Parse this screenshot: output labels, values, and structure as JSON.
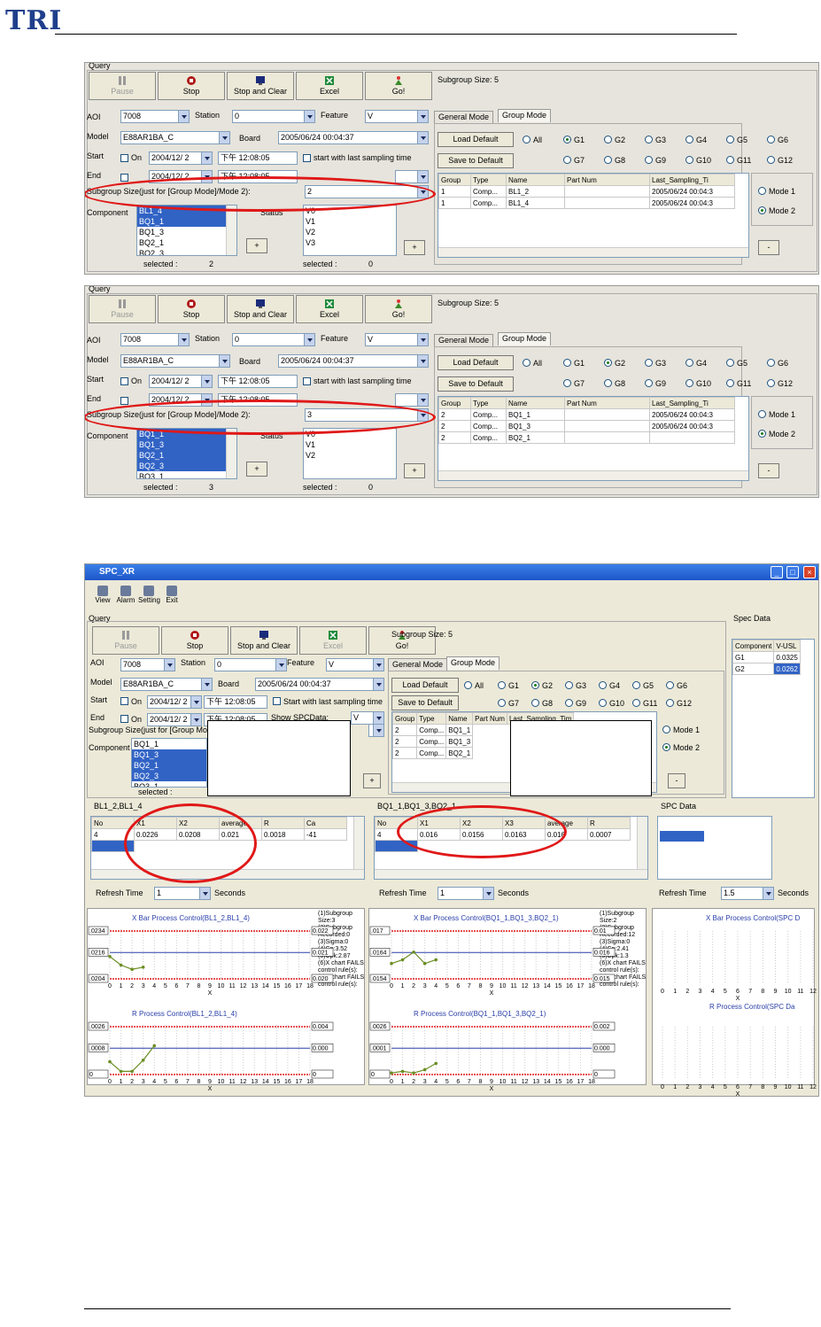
{
  "header": {
    "logo": "TRI"
  },
  "toolbar": {
    "pause": "Pause",
    "stop": "Stop",
    "stop_clear": "Stop and Clear",
    "excel": "Excel",
    "go": "Go!"
  },
  "panels": [
    {
      "query_label": "Query",
      "subgroup_size": "Subgroup Size:  5",
      "aoi_label": "AOI",
      "aoi": "7008",
      "station_label": "Station",
      "station": "0",
      "feature_label": "Feature",
      "feature": "V",
      "model_label": "Model",
      "model": "E88AR1BA_C",
      "board_label": "Board",
      "board": "2005/06/24 00:04:37",
      "start_label": "Start",
      "on_label": "On",
      "start_date": "2004/12/ 2",
      "start_time": "下午 12:08:05",
      "end_label": "End",
      "end_date": "2004/12/ 2",
      "end_time": "下午 12:08:05",
      "start_last": "start with last sampling time",
      "show_spc": "Show SPCData:",
      "subgroup_label": "Subgroup Size(just for [Group Mode]/Mode 2):",
      "subgroup_value": "2",
      "component_label": "Component",
      "components": [
        "BL1_4",
        "BQ1_1",
        "BQ1_3",
        "BQ2_1",
        "BQ2_3"
      ],
      "comp_sel": [
        0,
        1
      ],
      "selected_label": "selected :",
      "selected_count": "2",
      "status_label": "Status",
      "status_items": [
        "V0",
        "V1",
        "V2",
        "V3"
      ],
      "status_selected": "0",
      "tab_general": "General Mode",
      "tab_group": "Group Mode",
      "load_default": "Load Default",
      "save_default": "Save to Default",
      "groups": [
        "All",
        "G1",
        "G2",
        "G3",
        "G4",
        "G5",
        "G6",
        "G7",
        "G8",
        "G9",
        "G10",
        "G11",
        "G12"
      ],
      "group_on": 1,
      "table_headers": [
        "Group",
        "Type",
        "Name",
        "Part Num",
        "Last_Sampling_Ti"
      ],
      "rows": [
        [
          "1",
          "Comp...",
          "BL1_2",
          "",
          "2005/06/24 00:04:3"
        ],
        [
          "1",
          "Comp...",
          "BL1_4",
          "",
          "2005/06/24 00:04:3"
        ]
      ],
      "mode1": "Mode 1",
      "mode2": "Mode 2",
      "plus": "+",
      "minus": "-"
    },
    {
      "query_label": "Query",
      "subgroup_size": "Subgroup Size:  5",
      "aoi_label": "AOI",
      "aoi": "7008",
      "station_label": "Station",
      "station": "0",
      "feature_label": "Feature",
      "feature": "V",
      "model_label": "Model",
      "model": "E88AR1BA_C",
      "board_label": "Board",
      "board": "2005/06/24 00:04:37",
      "start_label": "Start",
      "on_label": "On",
      "start_date": "2004/12/ 2",
      "start_time": "下午 12:08:05",
      "end_label": "End",
      "end_date": "2004/12/ 2",
      "end_time": "下午 12:08:05",
      "start_last": "start with last sampling time",
      "show_spc": "Show SPCData:",
      "subgroup_label": "Subgroup Size(just for [Group Mode]/Mode 2):",
      "subgroup_value": "3",
      "component_label": "Component",
      "components": [
        "BQ1_1",
        "BQ1_3",
        "BQ2_1",
        "BQ2_3",
        "BQ3_1"
      ],
      "comp_sel": [
        0,
        1,
        2,
        3
      ],
      "selected_label": "selected :",
      "selected_count": "3",
      "status_label": "Status",
      "status_items": [
        "V0",
        "V1",
        "V2"
      ],
      "status_selected": "0",
      "tab_general": "General Mode",
      "tab_group": "Group Mode",
      "load_default": "Load Default",
      "save_default": "Save to Default",
      "groups": [
        "All",
        "G1",
        "G2",
        "G3",
        "G4",
        "G5",
        "G6",
        "G7",
        "G8",
        "G9",
        "G10",
        "G11",
        "G12"
      ],
      "group_on": 2,
      "table_headers": [
        "Group",
        "Type",
        "Name",
        "Part Num",
        "Last_Sampling_Ti"
      ],
      "rows": [
        [
          "2",
          "Comp...",
          "BQ1_1",
          "",
          "2005/06/24 00:04:3"
        ],
        [
          "2",
          "Comp...",
          "BQ1_3",
          "",
          "2005/06/24 00:04:3"
        ],
        [
          "2",
          "Comp...",
          "BQ2_1",
          "",
          ""
        ]
      ],
      "mode1": "Mode 1",
      "mode2": "Mode 2",
      "plus": "+",
      "minus": "-"
    }
  ],
  "window": {
    "title": "SPC_XR",
    "menu": [
      "View",
      "Alarm",
      "Setting",
      "Exit"
    ],
    "query_label": "Query",
    "subgroup_size": "Subgroup Size:  5",
    "aoi_label": "AOI",
    "aoi": "7008",
    "station_label": "Station",
    "station": "0",
    "feature_label": "Feature",
    "feature": "V",
    "model_label": "Model",
    "model": "E88AR1BA_C",
    "board_label": "Board",
    "board": "2005/06/24 00:04:37",
    "start_label": "Start",
    "on_label": "On",
    "start_date": "2004/12/ 2",
    "start_time": "下午 12:08:05",
    "end_label": "End",
    "end_date": "2004/12/ 2",
    "end_time": "下午 12:08:05",
    "start_last": "Start with last sampling time",
    "show_spc": "Show SPCData:",
    "show_spc_val": "V",
    "subgroup_label": "Subgroup Size(just for [Group Mod",
    "component_label": "Component",
    "components": [
      "BQ1_1",
      "BQ1_3",
      "BQ2_1",
      "BQ2_3",
      "BQ3_1"
    ],
    "comp_sel": [
      1,
      2,
      3
    ],
    "selected_label": "selected :",
    "tab_general": "General Mode",
    "tab_group": "Group Mode",
    "load_default": "Load Default",
    "save_default": "Save to Default",
    "groups": [
      "All",
      "G1",
      "G2",
      "G3",
      "G4",
      "G5",
      "G6",
      "G7",
      "G8",
      "G9",
      "G10",
      "G11",
      "G12"
    ],
    "group_on": 2,
    "table_headers": [
      "Group",
      "Type",
      "Name",
      "Part Num",
      "Last_Sampling_Tim"
    ],
    "rows": [
      [
        "2",
        "Comp...",
        "BQ1_1"
      ],
      [
        "2",
        "Comp...",
        "BQ1_3"
      ],
      [
        "2",
        "Comp...",
        "BQ2_1"
      ]
    ],
    "mode1": "Mode 1",
    "mode2": "Mode 2",
    "plus": "+",
    "minus": "-",
    "spec_label": "Spec Data",
    "spec_headers": [
      "Component",
      "V-USL"
    ],
    "spec_rows": [
      [
        "G1",
        "0.0325"
      ],
      [
        "G2",
        "0.0262"
      ]
    ],
    "grp1_label": "BL1_2,BL1_4",
    "grp1_headers": [
      "No",
      "X1",
      "X2",
      "average",
      "R",
      "Ca"
    ],
    "grp1_row": [
      "4",
      "0.0226",
      "0.0208",
      "0.021",
      "0.0018",
      "-41"
    ],
    "grp2_label": "BQ1_1,BQ1_3,BQ2_1",
    "grp2_headers": [
      "No",
      "X1",
      "X2",
      "X3",
      "average",
      "R"
    ],
    "grp2_row": [
      "4",
      "0.016",
      "0.0156",
      "0.0163",
      "0.016",
      "0.0007"
    ],
    "spc_label": "SPC Data",
    "refresh_label": "Refresh Time",
    "seconds": "Seconds",
    "refresh1": "1",
    "refresh2": "1",
    "refresh3": "1.5",
    "c1_xtitle": "X Bar Process Control(BL1_2,BL1_4)",
    "c1_rtitle": "R Process Control(BL1_2,BL1_4)",
    "c2_xtitle": "X Bar Process Control(BQ1_1,BQ1_3,BQ2_1)",
    "c2_rtitle": "R Process Control(BQ1_1,BQ1_3,BQ2_1)",
    "c3_xtitle": "X Bar Process Control(SPC D",
    "c3_rtitle": "R Process Control(SPC Da",
    "c1_side": "(1)Subgroup Size:3\n(2)Subgroup Recorded:0\n(3)Sigma:0\n(4)Cp:3.52\n(5)Cpk:2.87\n(6)X chart FAILS control rule(s):\n(7)R chart FAILS control rule(s):",
    "c2_side": "(1)Subgroup Size:2\n(2)Subgroup Recorded:12\n(3)Sigma:0\n(4)Cp:2.41\n(5)Cpk:1.3\n(6)X chart FAILS control rule(s):\n(7)R chart FAILS control rule(s):",
    "c1x_left": [
      ".0234",
      ".0216",
      ".0204"
    ],
    "c1x_right": [
      "0.022",
      "0.021",
      "0.020"
    ],
    "c1r_left": [
      ".0026",
      ".0008",
      "0"
    ],
    "c1r_right": [
      "0.004",
      "0.000",
      "0"
    ],
    "c2x_left": [
      ".017",
      ".0164",
      ".0154"
    ],
    "c2x_right": [
      "0.01",
      "0.016",
      "0.015"
    ],
    "c2r_left": [
      ".0026",
      ".0001",
      "0"
    ],
    "c2r_right": [
      "0.002",
      "0.000",
      "0"
    ],
    "x_ticks": [
      "0",
      "1",
      "2",
      "3",
      "4",
      "5",
      "6",
      "7",
      "8",
      "9",
      "10",
      "11",
      "12",
      "13",
      "14",
      "15",
      "16",
      "17",
      "18"
    ],
    "x_ticks3": [
      "0",
      "1",
      "2",
      "3",
      "4",
      "5",
      "6",
      "7",
      "8",
      "9",
      "10",
      "11",
      "12"
    ],
    "x_axis": "X"
  },
  "chart_data": [
    {
      "type": "line",
      "title": "X Bar Process Control(BL1_2,BL1_4)",
      "x": [
        0,
        1,
        2,
        3
      ],
      "values": [
        0.0216,
        0.0208,
        0.0204,
        0.0206
      ],
      "ylim": [
        0.0195,
        0.024
      ]
    },
    {
      "type": "line",
      "title": "R Process Control(BL1_2,BL1_4)",
      "x": [
        0,
        1,
        2,
        3,
        4
      ],
      "values": [
        0.0008,
        0.0002,
        0.0002,
        0.0009,
        0.0018
      ],
      "ylim": [
        0,
        0.003
      ]
    },
    {
      "type": "line",
      "title": "X Bar Process Control(BQ1_1,BQ1_3,BQ2_1)",
      "x": [
        0,
        1,
        2,
        3,
        4
      ],
      "values": [
        0.0158,
        0.016,
        0.0164,
        0.0158,
        0.016
      ],
      "ylim": [
        0.015,
        0.0175
      ]
    },
    {
      "type": "line",
      "title": "R Process Control(BQ1_1,BQ1_3,BQ2_1)",
      "x": [
        0,
        1,
        2,
        3,
        4
      ],
      "values": [
        0.0001,
        0.0002,
        0.0001,
        0.0003,
        0.0007
      ],
      "ylim": [
        0,
        0.003
      ]
    }
  ],
  "colors": {
    "annotation": "#e01818",
    "selection": "#3163c5",
    "line": "#6b8e23",
    "limit": "#e01818",
    "center": "#2a3fa8"
  }
}
